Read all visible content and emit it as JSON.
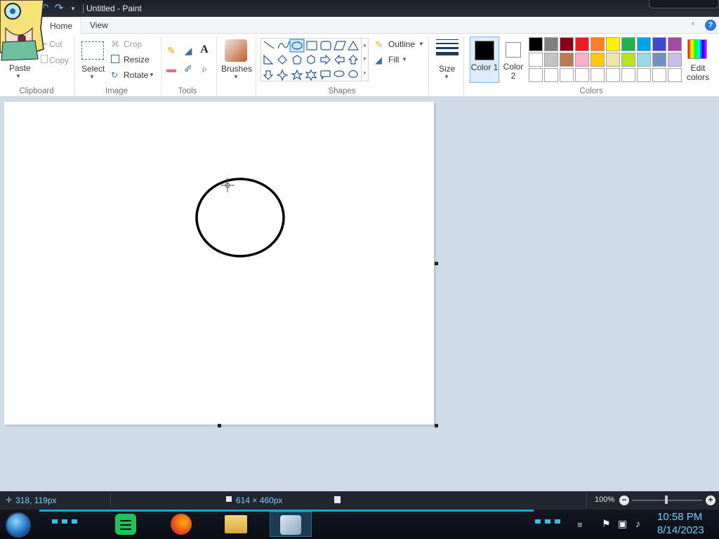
{
  "window": {
    "title": "Untitled - Paint"
  },
  "tabs": {
    "home": "Home",
    "view": "View"
  },
  "clipboard": {
    "paste": "Paste",
    "cut": "Cut",
    "copy": "Copy",
    "group": "Clipboard"
  },
  "image": {
    "select": "Select",
    "crop": "Crop",
    "resize": "Resize",
    "rotate": "Rotate",
    "group": "Image"
  },
  "tools": {
    "group": "Tools"
  },
  "brushes": {
    "label": "Brushes"
  },
  "shapes": {
    "outline": "Outline",
    "fill": "Fill",
    "group": "Shapes",
    "selected": "oval"
  },
  "size": {
    "label": "Size"
  },
  "colors": {
    "color1": "Color 1",
    "color1_value": "#000000",
    "color2": "Color 2",
    "color2_value": "#ffffff",
    "edit": "Edit colors",
    "group": "Colors",
    "palette_row1": [
      "#000000",
      "#7f7f7f",
      "#880015",
      "#ed1c24",
      "#ff7f27",
      "#fff200",
      "#22b14c",
      "#00a2e8",
      "#3f48cc",
      "#a349a4"
    ],
    "palette_row2": [
      "#ffffff",
      "#c3c3c3",
      "#b97a57",
      "#ffaec9",
      "#ffc90e",
      "#efe4b0",
      "#b5e61d",
      "#99d9ea",
      "#7092be",
      "#c8bfe7"
    ],
    "palette_row3": [
      "#ffffff",
      "#ffffff",
      "#ffffff",
      "#ffffff",
      "#ffffff",
      "#ffffff",
      "#ffffff",
      "#ffffff",
      "#ffffff",
      "#ffffff"
    ]
  },
  "status": {
    "cursor_pos": "318, 119px",
    "canvas_size": "614 × 460px",
    "zoom": "100%"
  },
  "clock": {
    "time": "10:58 PM",
    "date": "8/14/2023"
  }
}
